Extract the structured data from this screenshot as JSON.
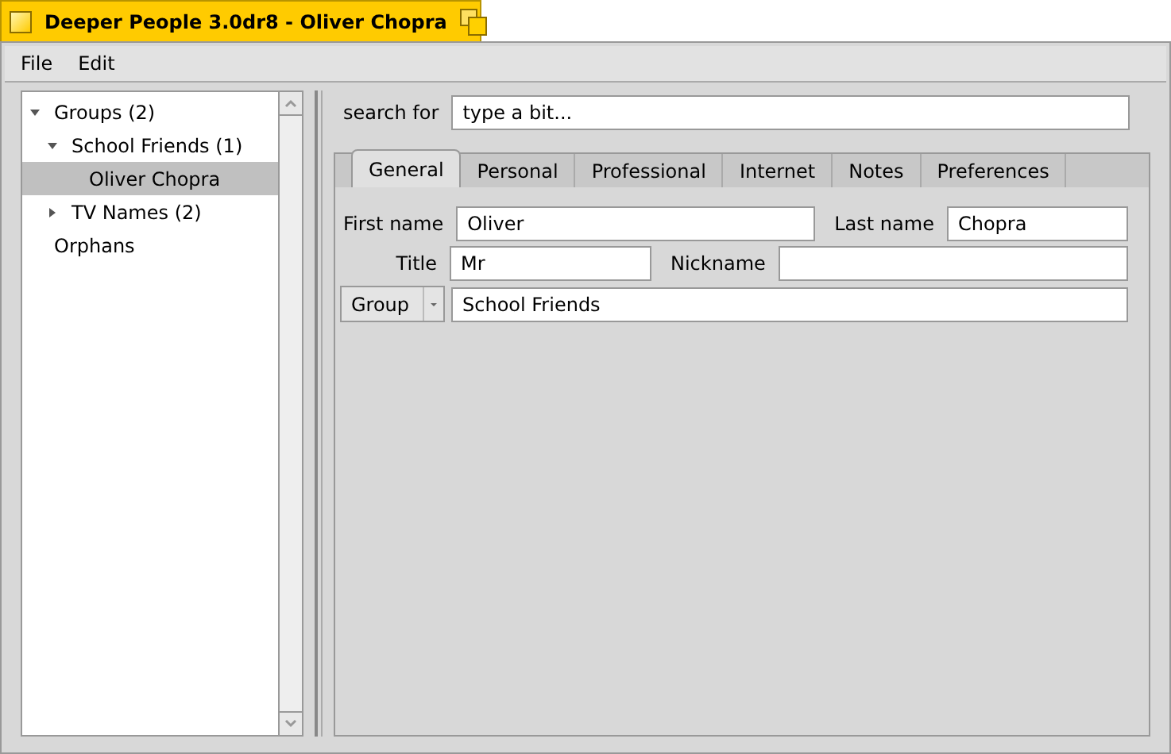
{
  "window": {
    "title": "Deeper People 3.0dr8 - Oliver Chopra"
  },
  "menu": [
    "File",
    "Edit"
  ],
  "tree": [
    {
      "label": "Groups (2)",
      "expanded": true,
      "selected": false,
      "children": [
        {
          "label": "School Friends (1)",
          "expanded": true,
          "selected": false,
          "children": [
            {
              "label": "Oliver Chopra",
              "selected": true
            }
          ]
        },
        {
          "label": "TV Names (2)",
          "expanded": false,
          "selected": false
        }
      ]
    },
    {
      "label": "Orphans",
      "selected": false
    }
  ],
  "search": {
    "label": "search for",
    "value": "type a bit..."
  },
  "tabs": [
    {
      "label": "General",
      "selected": true
    },
    {
      "label": "Personal",
      "selected": false
    },
    {
      "label": "Professional",
      "selected": false
    },
    {
      "label": "Internet",
      "selected": false
    },
    {
      "label": "Notes",
      "selected": false
    },
    {
      "label": "Preferences",
      "selected": false
    }
  ],
  "form": {
    "first_name": {
      "label": "First name",
      "value": "Oliver"
    },
    "last_name": {
      "label": "Last name",
      "value": "Chopra"
    },
    "title": {
      "label": "Title",
      "value": "Mr"
    },
    "nickname": {
      "label": "Nickname"
    },
    "group": {
      "label": "Group",
      "value": "School Friends"
    }
  }
}
